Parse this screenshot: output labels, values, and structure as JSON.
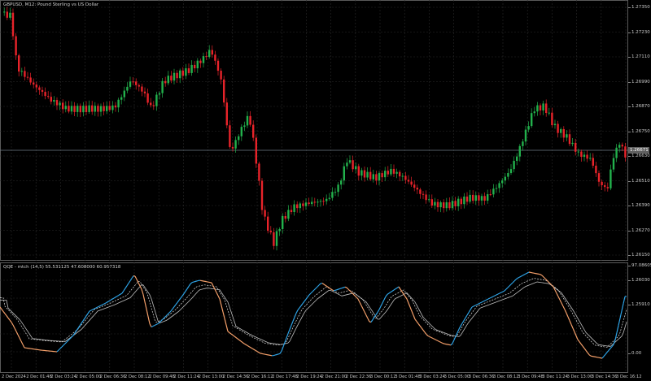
{
  "chart": {
    "title": "GBPUSD, M12:  Pound Sterling vs US Dollar",
    "current_price": "1.26671",
    "colors": {
      "bull": "#22b14c",
      "bear": "#e8232a",
      "grid": "#2a2a2a",
      "price_line": "#6e7a85"
    }
  },
  "indicator": {
    "title": "QQE - mtch (14,5) 55.531125 47.608000 60.957318",
    "colors": {
      "rsi_up": "#2ea3e6",
      "rsi_down": "#f5a06a",
      "fast": "#bdbdbd",
      "slow": "#e0e0e0"
    }
  },
  "price_axis": [
    "1.27350",
    "1.27230",
    "1.27110",
    "1.26990",
    "1.26870",
    "1.26750",
    "1.26630",
    "1.26510",
    "1.26390",
    "1.26270",
    "1.26150",
    "1.26030",
    "1.25910"
  ],
  "indicator_axis": [
    "97.086057",
    "0.00"
  ],
  "time_axis": [
    "2 Dec 2024",
    "2 Dec 01:48",
    "2 Dec 03:24",
    "2 Dec 05:00",
    "2 Dec 06:36",
    "2 Dec 08:12",
    "2 Dec 09:48",
    "2 Dec 11:24",
    "2 Dec 13:00",
    "2 Dec 14:36",
    "2 Dec 16:12",
    "2 Dec 17:48",
    "2 Dec 19:24",
    "2 Dec 21:00",
    "2 Dec 22:36",
    "3 Dec 00:12",
    "3 Dec 01:48",
    "3 Dec 03:24",
    "3 Dec 05:00",
    "3 Dec 06:36",
    "3 Dec 08:12",
    "3 Dec 09:48",
    "3 Dec 11:24",
    "3 Dec 13:00",
    "3 Dec 14:36",
    "3 Dec 16:12"
  ]
}
